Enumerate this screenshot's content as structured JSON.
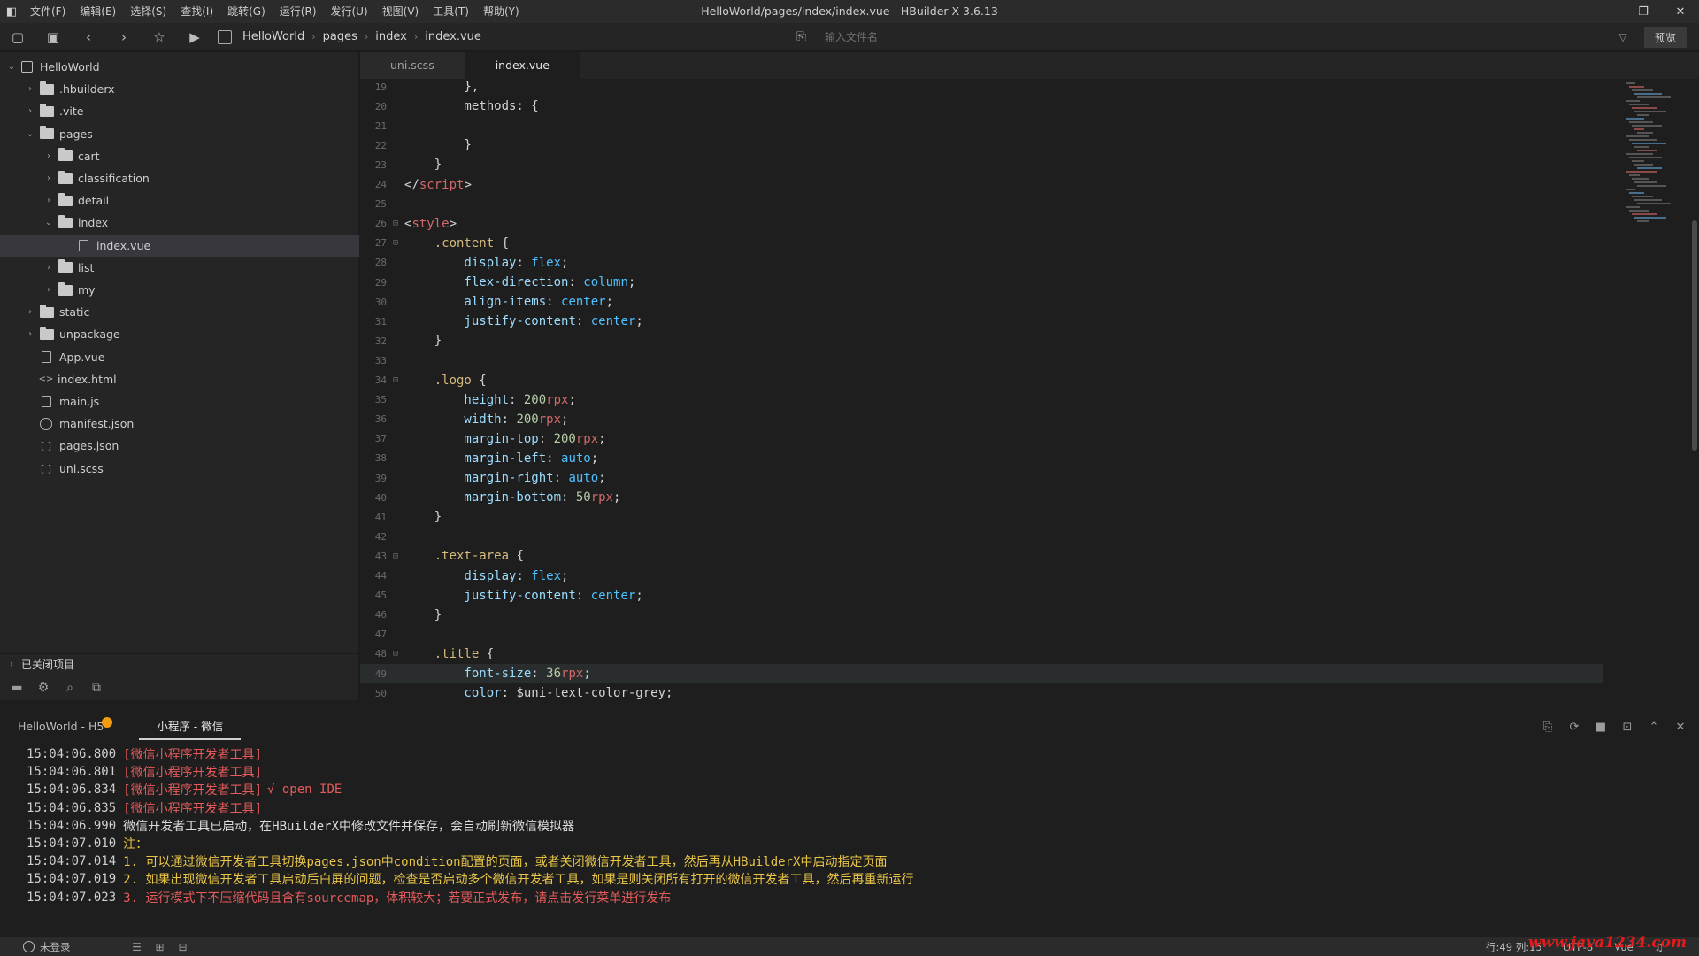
{
  "menubar": {
    "items": [
      "文件(F)",
      "编辑(E)",
      "选择(S)",
      "查找(I)",
      "跳转(G)",
      "运行(R)",
      "发行(U)",
      "视图(V)",
      "工具(T)",
      "帮助(Y)"
    ],
    "window_title": "HelloWorld/pages/index/index.vue - HBuilder X 3.6.13"
  },
  "toolbar": {
    "breadcrumb": [
      "HelloWorld",
      "pages",
      "index",
      "index.vue"
    ],
    "file_search_placeholder": "输入文件名",
    "preview_label": "预览"
  },
  "sidebar": {
    "tree": [
      {
        "label": "HelloWorld",
        "level": 0,
        "chevron": "down",
        "icon": "project"
      },
      {
        "label": ".hbuilderx",
        "level": 1,
        "chevron": "right",
        "icon": "folder"
      },
      {
        "label": ".vite",
        "level": 1,
        "chevron": "right",
        "icon": "folder"
      },
      {
        "label": "pages",
        "level": 1,
        "chevron": "down",
        "icon": "folder"
      },
      {
        "label": "cart",
        "level": 2,
        "chevron": "right",
        "icon": "folder"
      },
      {
        "label": "classification",
        "level": 2,
        "chevron": "right",
        "icon": "folder"
      },
      {
        "label": "detail",
        "level": 2,
        "chevron": "right",
        "icon": "folder"
      },
      {
        "label": "index",
        "level": 2,
        "chevron": "down",
        "icon": "folder"
      },
      {
        "label": "index.vue",
        "level": 3,
        "chevron": "",
        "icon": "file",
        "selected": true
      },
      {
        "label": "list",
        "level": 2,
        "chevron": "right",
        "icon": "folder"
      },
      {
        "label": "my",
        "level": 2,
        "chevron": "right",
        "icon": "folder"
      },
      {
        "label": "static",
        "level": 1,
        "chevron": "right",
        "icon": "folder"
      },
      {
        "label": "unpackage",
        "level": 1,
        "chevron": "right",
        "icon": "folder"
      },
      {
        "label": "App.vue",
        "level": 1,
        "chevron": "",
        "icon": "file"
      },
      {
        "label": "index.html",
        "level": 1,
        "chevron": "",
        "icon": "code"
      },
      {
        "label": "main.js",
        "level": 1,
        "chevron": "",
        "icon": "file"
      },
      {
        "label": "manifest.json",
        "level": 1,
        "chevron": "",
        "icon": "gear"
      },
      {
        "label": "pages.json",
        "level": 1,
        "chevron": "",
        "icon": "brace"
      },
      {
        "label": "uni.scss",
        "level": 1,
        "chevron": "",
        "icon": "brace"
      }
    ],
    "closed_projects": "已关闭项目"
  },
  "editor": {
    "tabs": [
      {
        "label": "uni.scss",
        "active": false
      },
      {
        "label": "index.vue",
        "active": true
      }
    ],
    "lines": [
      {
        "n": "19",
        "fold": "",
        "tokens": [
          [
            "",
            "        },"
          ]
        ]
      },
      {
        "n": "20",
        "fold": "",
        "tokens": [
          [
            "",
            "        methods: {"
          ]
        ]
      },
      {
        "n": "21",
        "fold": "",
        "tokens": [
          [
            "",
            ""
          ]
        ]
      },
      {
        "n": "22",
        "fold": "",
        "tokens": [
          [
            "",
            "        }"
          ]
        ]
      },
      {
        "n": "23",
        "fold": "",
        "tokens": [
          [
            "",
            "    }"
          ]
        ]
      },
      {
        "n": "24",
        "fold": "",
        "tokens": [
          [
            "brk",
            "</"
          ],
          [
            "tag",
            "script"
          ],
          [
            "brk",
            ">"
          ]
        ]
      },
      {
        "n": "25",
        "fold": "",
        "tokens": [
          [
            "",
            ""
          ]
        ]
      },
      {
        "n": "26",
        "fold": "⊟",
        "tokens": [
          [
            "brk",
            "<"
          ],
          [
            "tag",
            "style"
          ],
          [
            "brk",
            ">"
          ]
        ]
      },
      {
        "n": "27",
        "fold": "⊟",
        "tokens": [
          [
            "sel",
            "    .content"
          ],
          [
            "",
            " {"
          ]
        ]
      },
      {
        "n": "28",
        "fold": "",
        "tokens": [
          [
            "prop",
            "        display"
          ],
          [
            "",
            ": "
          ],
          [
            "val",
            "flex"
          ],
          [
            "",
            ";"
          ]
        ]
      },
      {
        "n": "29",
        "fold": "",
        "tokens": [
          [
            "prop",
            "        flex-direction"
          ],
          [
            "",
            ": "
          ],
          [
            "val",
            "column"
          ],
          [
            "",
            ";"
          ]
        ]
      },
      {
        "n": "30",
        "fold": "",
        "tokens": [
          [
            "prop",
            "        align-items"
          ],
          [
            "",
            ": "
          ],
          [
            "val",
            "center"
          ],
          [
            "",
            ";"
          ]
        ]
      },
      {
        "n": "31",
        "fold": "",
        "tokens": [
          [
            "prop",
            "        justify-content"
          ],
          [
            "",
            ": "
          ],
          [
            "val",
            "center"
          ],
          [
            "",
            ";"
          ]
        ]
      },
      {
        "n": "32",
        "fold": "",
        "tokens": [
          [
            "",
            "    }"
          ]
        ]
      },
      {
        "n": "33",
        "fold": "",
        "tokens": [
          [
            "",
            ""
          ]
        ]
      },
      {
        "n": "34",
        "fold": "⊟",
        "tokens": [
          [
            "sel",
            "    .logo"
          ],
          [
            "",
            " {"
          ]
        ]
      },
      {
        "n": "35",
        "fold": "",
        "tokens": [
          [
            "prop",
            "        height"
          ],
          [
            "",
            ": "
          ],
          [
            "num",
            "200"
          ],
          [
            "unit",
            "rpx"
          ],
          [
            "",
            ";"
          ]
        ]
      },
      {
        "n": "36",
        "fold": "",
        "tokens": [
          [
            "prop",
            "        width"
          ],
          [
            "",
            ": "
          ],
          [
            "num",
            "200"
          ],
          [
            "unit",
            "rpx"
          ],
          [
            "",
            ";"
          ]
        ]
      },
      {
        "n": "37",
        "fold": "",
        "tokens": [
          [
            "prop",
            "        margin-top"
          ],
          [
            "",
            ": "
          ],
          [
            "num",
            "200"
          ],
          [
            "unit",
            "rpx"
          ],
          [
            "",
            ";"
          ]
        ]
      },
      {
        "n": "38",
        "fold": "",
        "tokens": [
          [
            "prop",
            "        margin-left"
          ],
          [
            "",
            ": "
          ],
          [
            "val",
            "auto"
          ],
          [
            "",
            ";"
          ]
        ]
      },
      {
        "n": "39",
        "fold": "",
        "tokens": [
          [
            "prop",
            "        margin-right"
          ],
          [
            "",
            ": "
          ],
          [
            "val",
            "auto"
          ],
          [
            "",
            ";"
          ]
        ]
      },
      {
        "n": "40",
        "fold": "",
        "tokens": [
          [
            "prop",
            "        margin-bottom"
          ],
          [
            "",
            ": "
          ],
          [
            "num",
            "50"
          ],
          [
            "unit",
            "rpx"
          ],
          [
            "",
            ";"
          ]
        ]
      },
      {
        "n": "41",
        "fold": "",
        "tokens": [
          [
            "",
            "    }"
          ]
        ]
      },
      {
        "n": "42",
        "fold": "",
        "tokens": [
          [
            "",
            ""
          ]
        ]
      },
      {
        "n": "43",
        "fold": "⊟",
        "tokens": [
          [
            "sel",
            "    .text-area"
          ],
          [
            "",
            " {"
          ]
        ]
      },
      {
        "n": "44",
        "fold": "",
        "tokens": [
          [
            "prop",
            "        display"
          ],
          [
            "",
            ": "
          ],
          [
            "val",
            "flex"
          ],
          [
            "",
            ";"
          ]
        ]
      },
      {
        "n": "45",
        "fold": "",
        "tokens": [
          [
            "prop",
            "        justify-content"
          ],
          [
            "",
            ": "
          ],
          [
            "val",
            "center"
          ],
          [
            "",
            ";"
          ]
        ]
      },
      {
        "n": "46",
        "fold": "",
        "tokens": [
          [
            "",
            "    }"
          ]
        ]
      },
      {
        "n": "47",
        "fold": "",
        "tokens": [
          [
            "",
            ""
          ]
        ]
      },
      {
        "n": "48",
        "fold": "⊟",
        "tokens": [
          [
            "sel",
            "    .title"
          ],
          [
            "",
            " {"
          ]
        ]
      },
      {
        "n": "49",
        "fold": "",
        "tokens": [
          [
            "prop",
            "        font-size"
          ],
          [
            "",
            ": "
          ],
          [
            "num",
            "36"
          ],
          [
            "unit",
            "rpx"
          ],
          [
            "",
            ";"
          ]
        ],
        "current": true
      },
      {
        "n": "50",
        "fold": "",
        "tokens": [
          [
            "prop",
            "        color"
          ],
          [
            "",
            ": "
          ],
          [
            "var",
            "$uni-text-color-grey"
          ],
          [
            "",
            ";"
          ]
        ]
      }
    ]
  },
  "console": {
    "tabs": [
      {
        "label": "HelloWorld - H5",
        "active": false,
        "badge": true
      },
      {
        "label": "小程序 - 微信",
        "active": true
      }
    ],
    "lines": [
      {
        "ts": "15:04:06.800",
        "parts": [
          [
            "tag",
            "[微信小程序开发者工具]"
          ]
        ]
      },
      {
        "ts": "15:04:06.801",
        "parts": [
          [
            "tag",
            "[微信小程序开发者工具]"
          ]
        ]
      },
      {
        "ts": "15:04:06.834",
        "parts": [
          [
            "tag",
            "[微信小程序开发者工具]"
          ],
          [
            "ok",
            "√ open IDE"
          ]
        ]
      },
      {
        "ts": "15:04:06.835",
        "parts": [
          [
            "tag",
            "[微信小程序开发者工具]"
          ]
        ]
      },
      {
        "ts": "15:04:06.990",
        "parts": [
          [
            "info",
            "微信开发者工具已启动，在HBuilderX中修改文件并保存，会自动刷新微信模拟器"
          ]
        ]
      },
      {
        "ts": "15:04:07.010",
        "parts": [
          [
            "warn",
            "注："
          ]
        ]
      },
      {
        "ts": "15:04:07.014",
        "parts": [
          [
            "warn",
            "1. 可以通过微信开发者工具切换pages.json中condition配置的页面，或者关闭微信开发者工具，然后再从HBuilderX中启动指定页面"
          ]
        ]
      },
      {
        "ts": "15:04:07.019",
        "parts": [
          [
            "warn",
            "2. 如果出现微信开发者工具启动后白屏的问题，检查是否启动多个微信开发者工具，如果是则关闭所有打开的微信开发者工具，然后再重新运行"
          ]
        ]
      },
      {
        "ts": "15:04:07.023",
        "parts": [
          [
            "err",
            "3. 运行模式下不压缩代码且含有sourcemap，体积较大；若要正式发布，请点击发行菜单进行发布"
          ]
        ]
      }
    ]
  },
  "statusbar": {
    "login": "未登录",
    "position": "行:49  列:15",
    "encoding": "UTF-8",
    "language": "Vue",
    "watermark": "www.java1234.com"
  }
}
